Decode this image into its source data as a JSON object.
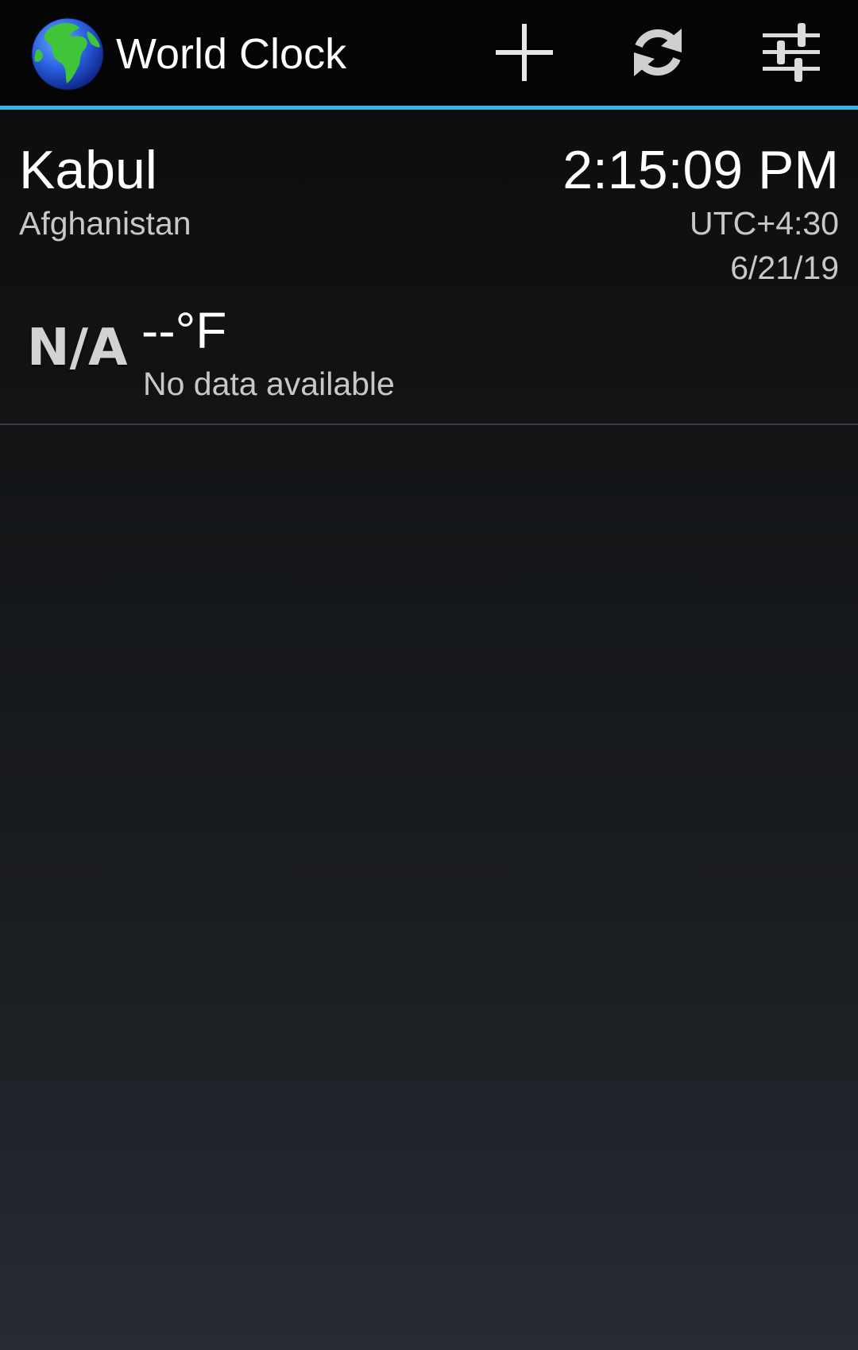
{
  "app": {
    "title": "World Clock",
    "accent_color": "#33b5e5",
    "icon": "globe-icon"
  },
  "actions": [
    {
      "name": "add",
      "icon": "plus-icon"
    },
    {
      "name": "refresh",
      "icon": "refresh-icon"
    },
    {
      "name": "settings",
      "icon": "sliders-icon"
    }
  ],
  "clocks": [
    {
      "city": "Kabul",
      "country": "Afghanistan",
      "time": "2:15:09 PM",
      "utc_offset": "UTC+4:30",
      "date": "6/21/19",
      "weather": {
        "icon_text": "N/A",
        "temperature": "--°F",
        "description": "No data available"
      }
    }
  ]
}
